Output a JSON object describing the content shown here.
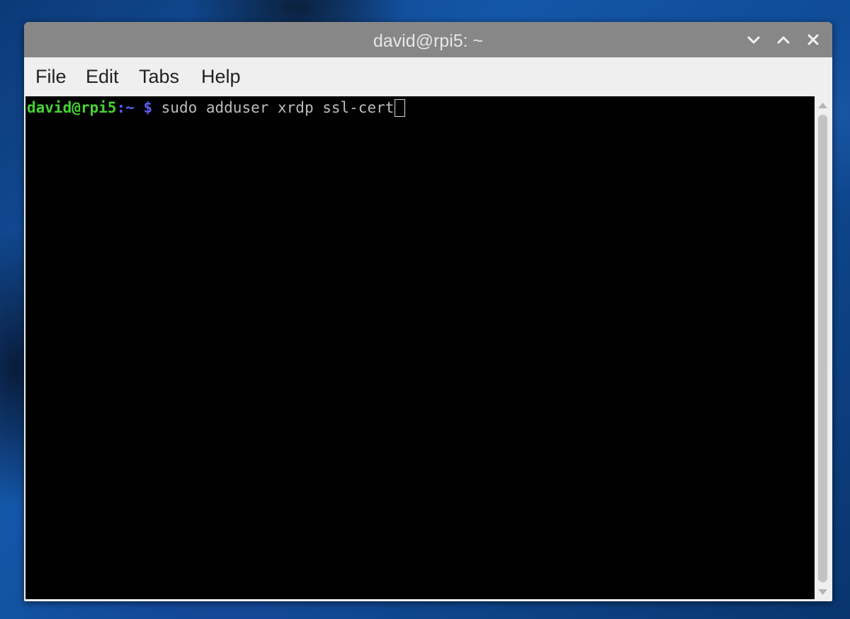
{
  "window": {
    "title": "david@rpi5: ~",
    "controls": {
      "minimize_icon": "chevron-down-icon",
      "maximize_icon": "chevron-up-icon",
      "close_icon": "close-icon"
    }
  },
  "menubar": {
    "items": [
      {
        "label": "File"
      },
      {
        "label": "Edit"
      },
      {
        "label": "Tabs"
      },
      {
        "label": "Help"
      }
    ]
  },
  "terminal": {
    "prompt_user": "david@rpi5",
    "prompt_path": ":~ $",
    "command": " sudo adduser xrdp ssl-cert",
    "colors": {
      "background": "#000000",
      "user": "#44d430",
      "path": "#5a5ff0",
      "text": "#bcbcbc"
    }
  },
  "scrollbar": {
    "up_icon": "scroll-up-arrow-icon",
    "down_icon": "scroll-down-arrow-icon"
  }
}
